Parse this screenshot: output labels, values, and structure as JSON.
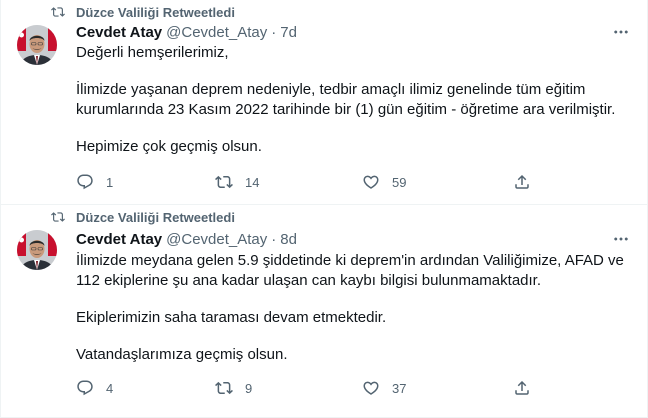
{
  "tweets": [
    {
      "retweeted_by": "Düzce Valiliği Retweetledi",
      "name": "Cevdet Atay",
      "handle": "@Cevdet_Atay",
      "separator": "·",
      "time": "7d",
      "lines": [
        "Değerli hemşerilerimiz,",
        "İlimizde yaşanan deprem nedeniyle, tedbir amaçlı ilimiz genelinde tüm eğitim kurumlarında 23 Kasım 2022 tarihinde bir (1) gün eğitim - öğretime ara verilmiştir.",
        "Hepimize çok geçmiş olsun."
      ],
      "replies": "1",
      "retweets": "14",
      "likes": "59"
    },
    {
      "retweeted_by": "Düzce Valiliği Retweetledi",
      "name": "Cevdet Atay",
      "handle": "@Cevdet_Atay",
      "separator": "·",
      "time": "8d",
      "lines": [
        "İlimizde meydana gelen 5.9 şiddetinde ki deprem'in ardından Valiliğimize, AFAD ve 112 ekiplerine şu ana kadar ulaşan can kaybı bilgisi bulunmamaktadır.",
        "Ekiplerimizin saha taraması devam etmektedir.",
        "Vatandaşlarımıza geçmiş olsun."
      ],
      "replies": "4",
      "retweets": "9",
      "likes": "37"
    }
  ],
  "icons": {
    "retweet": "retweet-icon",
    "more": "more-icon",
    "reply": "reply-icon",
    "like": "heart-icon",
    "share": "share-icon"
  },
  "colors": {
    "secondary_text": "#536471",
    "primary_text": "#0f1419",
    "divider": "#eff3f4"
  }
}
